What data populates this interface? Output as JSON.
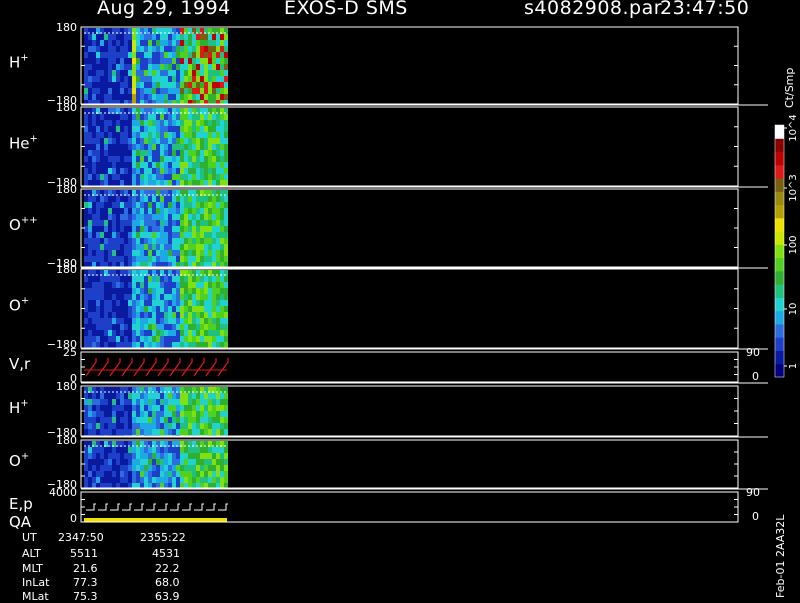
{
  "header": {
    "date": "Aug 29, 1994",
    "instrument": "EXOS-D SMS",
    "file": "s4082908.par",
    "time": "23:47:50"
  },
  "colorbar": {
    "unit": "Ct/Smp",
    "ticks": [
      "1",
      "10",
      "100",
      "10^3",
      "10^4"
    ],
    "colors": [
      "#000080",
      "#0a1aa0",
      "#1e40c8",
      "#2a6ee0",
      "#1ea8e6",
      "#20d2d2",
      "#20c080",
      "#30b030",
      "#50d020",
      "#80e010",
      "#c8e800",
      "#f0e000",
      "#b4a000",
      "#9a8a10",
      "#786010",
      "#e01818",
      "#c00000",
      "#8a0000",
      "#ffffff"
    ]
  },
  "panels": [
    {
      "label": "H",
      "sup": "+",
      "ytop": "180",
      "ybot": "−180"
    },
    {
      "label": "He",
      "sup": "+",
      "ytop": "180",
      "ybot": "−180"
    },
    {
      "label": "O",
      "sup": "++",
      "ytop": "180",
      "ybot": "−180"
    },
    {
      "label": "O",
      "sup": "+",
      "ytop": "180",
      "ybot": "−180"
    },
    {
      "label": "V,r",
      "sup": "",
      "ytop": "25",
      "ybot": "0",
      "rtop": "90",
      "rbot": "0"
    },
    {
      "label": "H",
      "sup": "+",
      "ytop": "180",
      "ybot": "−180"
    },
    {
      "label": "O",
      "sup": "+",
      "ytop": "180",
      "ybot": "−180"
    },
    {
      "label": "E,p",
      "sup": "",
      "label2": "QA",
      "ytop": "4000",
      "ybot": "0",
      "rtop": "90",
      "rbot": "0"
    }
  ],
  "footer": {
    "labels": [
      "UT",
      "ALT",
      "MLT",
      "InLat",
      "MLat"
    ],
    "col1": [
      "2347:50",
      "5511",
      "21.6",
      "77.3",
      "75.3"
    ],
    "col2": [
      "2355:22",
      "4531",
      "22.2",
      "68.0",
      "63.9"
    ]
  },
  "stamp": "Feb-01 2AA32L",
  "chart_data": {
    "type": "heatmap",
    "title": "Aug 29, 1994   EXOS-D SMS",
    "series": [
      {
        "name": "H+"
      },
      {
        "name": "He+"
      },
      {
        "name": "O++"
      },
      {
        "name": "O+"
      },
      {
        "name": "V,r"
      },
      {
        "name": "H+"
      },
      {
        "name": "O+"
      },
      {
        "name": "E,p"
      }
    ],
    "x_labels": [
      "2347:50",
      "2355:22"
    ],
    "y_ranges": [
      [
        -180,
        180
      ],
      [
        -180,
        180
      ],
      [
        -180,
        180
      ],
      [
        -180,
        180
      ],
      [
        0,
        25
      ],
      [
        -180,
        180
      ],
      [
        -180,
        180
      ],
      [
        0,
        4000
      ]
    ],
    "colorbar_range": [
      1,
      10000
    ],
    "colorbar_scale": "log"
  }
}
